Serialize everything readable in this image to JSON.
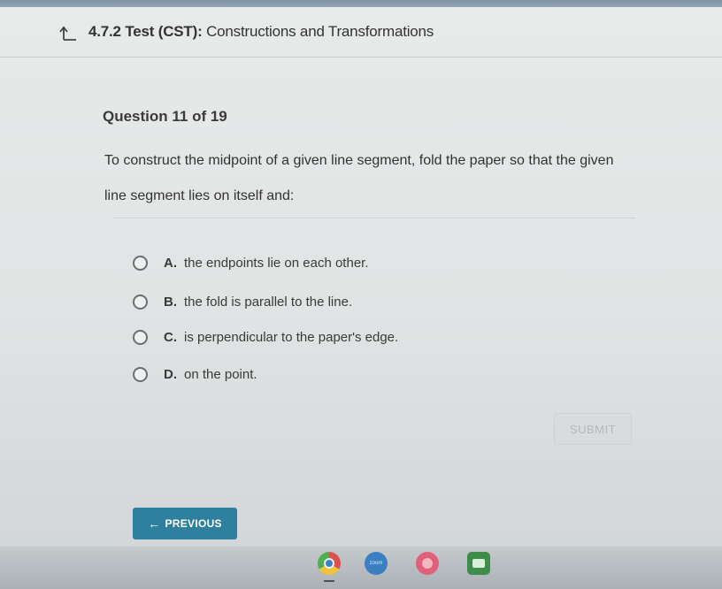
{
  "header": {
    "code": "4.7.2",
    "title_bold": "Test (CST):",
    "title_rest": "Constructions and Transformations"
  },
  "question": {
    "label": "Question 11 of 19",
    "prompt": "To construct the midpoint of a given line segment, fold the paper so that the given line segment lies on itself and:",
    "options": [
      {
        "letter": "A.",
        "text": "the endpoints lie on each other."
      },
      {
        "letter": "B.",
        "text": "the fold is parallel to the line."
      },
      {
        "letter": "C.",
        "text": "is perpendicular to the paper's edge."
      },
      {
        "letter": "D.",
        "text": "on the point."
      }
    ]
  },
  "buttons": {
    "submit": "SUBMIT",
    "previous": "PREVIOUS"
  },
  "taskbar": {
    "zoom_label": "zoom"
  },
  "icons": [
    "back-arrow-icon",
    "chrome-icon",
    "zoom-icon",
    "app-icon",
    "classroom-icon"
  ],
  "colors": {
    "previous_button": "#2f7f9e",
    "submit_disabled": "#d9dcdc"
  }
}
